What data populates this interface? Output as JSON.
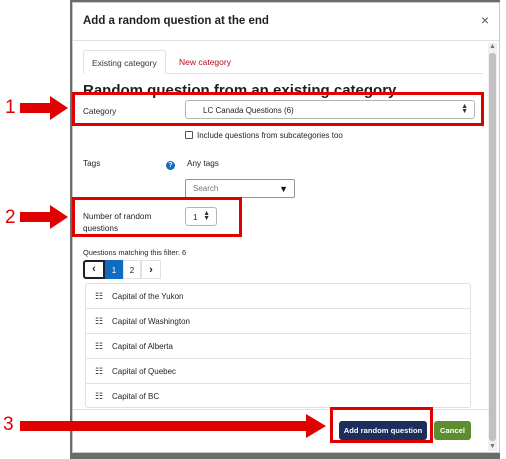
{
  "modal": {
    "title": "Add a random question at the end",
    "close": "×"
  },
  "tabs": [
    {
      "label": "Existing category",
      "active": true
    },
    {
      "label": "New category",
      "active": false
    }
  ],
  "heading": "Random question from an existing category",
  "category": {
    "label": "Category",
    "value": "LC Canada Questions (6)"
  },
  "subcategories": {
    "label": "Include questions from subcategories too",
    "checked": false
  },
  "tags": {
    "label": "Tags",
    "value": "Any tags",
    "search_placeholder": "Search"
  },
  "number": {
    "label_line1": "Number of random",
    "label_line2": "questions",
    "value": "1"
  },
  "matching": {
    "label": "Questions matching this filter: 6"
  },
  "pager": {
    "prev": "‹",
    "pages": [
      "1",
      "2"
    ],
    "current": "1",
    "next": "›"
  },
  "questions": [
    "Capital of the Yukon",
    "Capital of Washington",
    "Capital of Alberta",
    "Capital of Quebec",
    "Capital of BC"
  ],
  "buttons": {
    "add": "Add random question",
    "cancel": "Cancel"
  },
  "annotations": [
    "1",
    "2",
    "3"
  ],
  "colors": {
    "annotation": "#e10000",
    "primary_button": "#1d2e5c",
    "cancel_button": "#5c8d2f",
    "link": "#0f6cbf",
    "tab_inactive": "#b0111e"
  }
}
